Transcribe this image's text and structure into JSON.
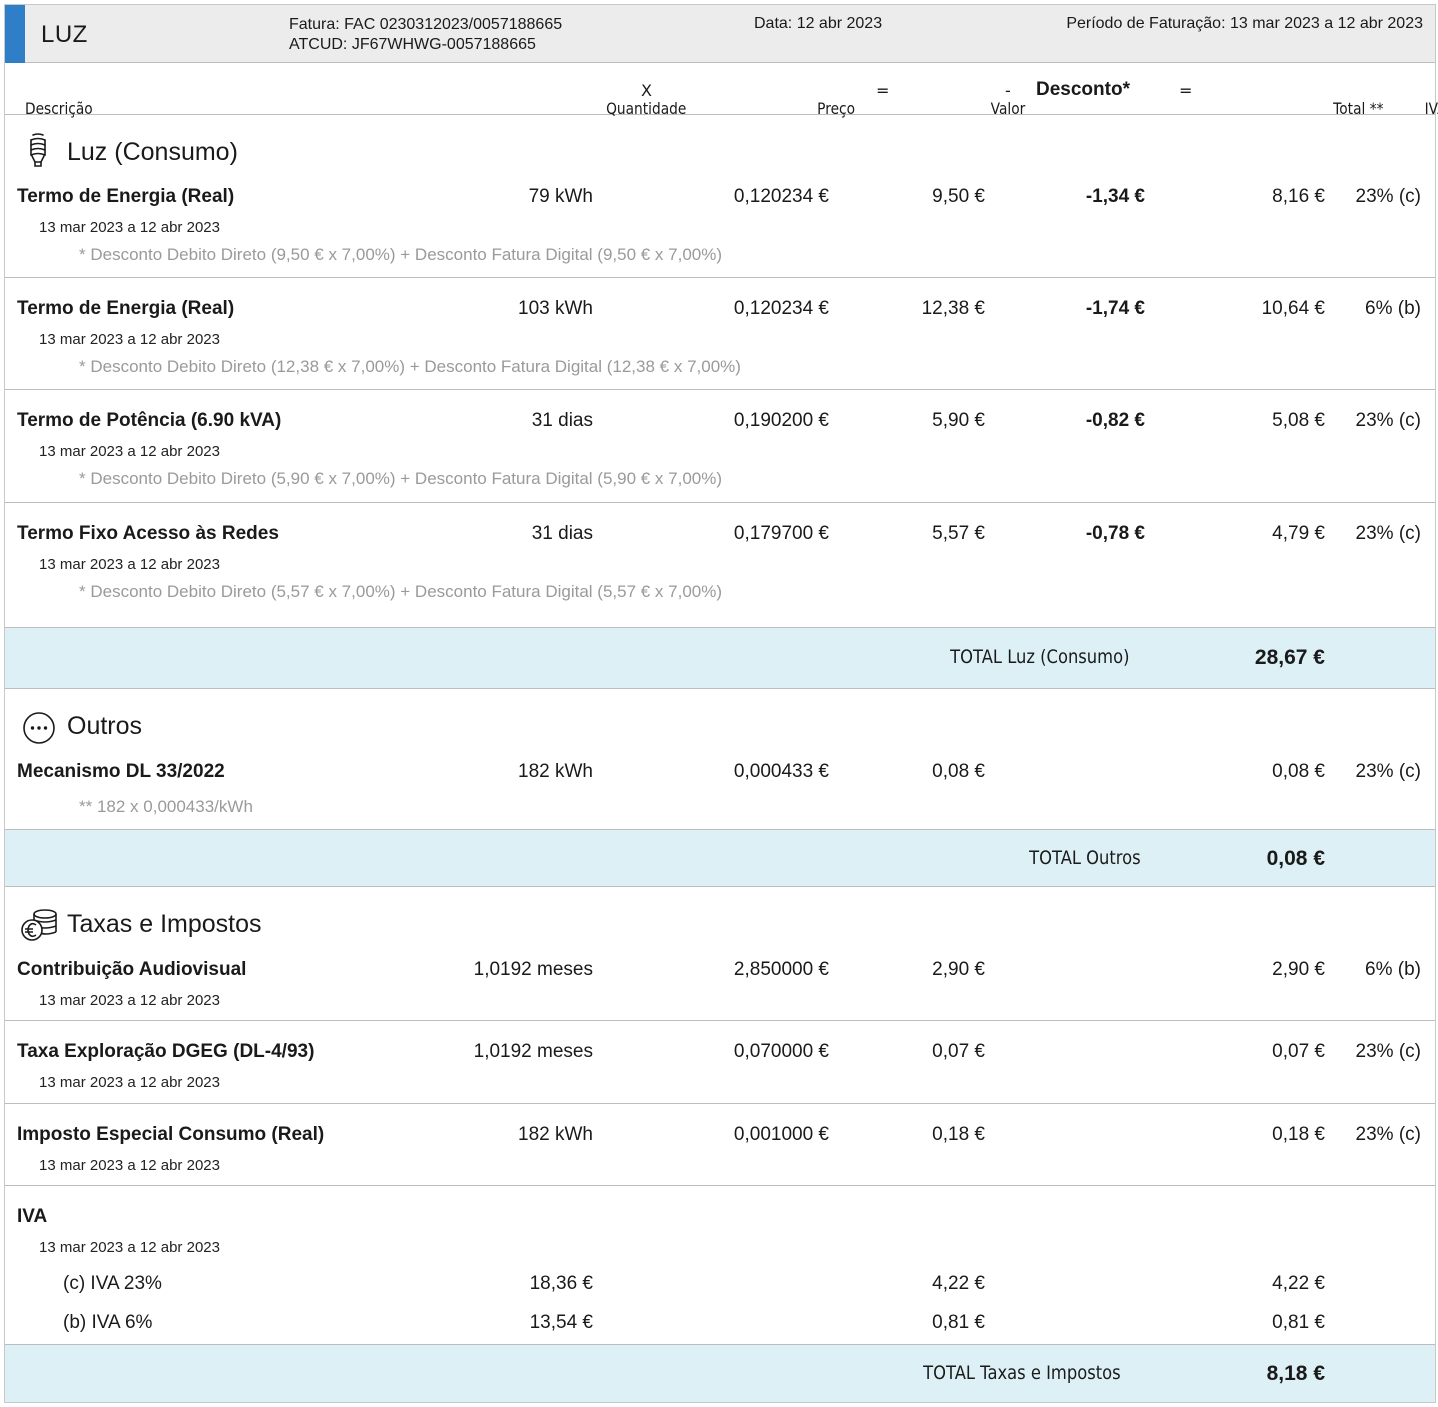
{
  "header": {
    "title": "LUZ",
    "fatura": "Fatura: FAC 0230312023/0057188665",
    "atcud": "ATCUD: JF67WHWG-0057188665",
    "data": "Data: 12 abr 2023",
    "periodo": "Período de Faturação:  13 mar 2023 a 12 abr 2023"
  },
  "columns": {
    "descricao": "Descrição",
    "quantidade": "Quantidade",
    "x": "X",
    "preco": "Preço",
    "eq1": "=",
    "valor": "Valor",
    "minus": "-",
    "desconto": "Desconto*",
    "eq2": "=",
    "total": "Total **",
    "iva": "IVA"
  },
  "sections": {
    "luz": {
      "title": "Luz (Consumo)",
      "icon": "lightbulb-icon",
      "items": [
        {
          "name": "Termo de Energia (Real)",
          "qty": "79 kWh",
          "price": "0,120234 €",
          "value": "9,50 €",
          "discount": "-1,34 €",
          "total": "8,16 €",
          "iva": "23% (c)",
          "period": "13 mar 2023 a 12 abr 2023",
          "note": "* Desconto Debito Direto (9,50 € x 7,00%) + Desconto Fatura Digital (9,50 € x 7,00%)"
        },
        {
          "name": "Termo de Energia (Real)",
          "qty": "103 kWh",
          "price": "0,120234 €",
          "value": "12,38 €",
          "discount": "-1,74 €",
          "total": "10,64 €",
          "iva": "6% (b)",
          "period": "13 mar 2023 a 12 abr 2023",
          "note": "* Desconto Debito Direto (12,38 € x 7,00%) + Desconto Fatura Digital (12,38 € x 7,00%)"
        },
        {
          "name": "Termo de Potência (6.90 kVA)",
          "qty": "31 dias",
          "price": "0,190200 €",
          "value": "5,90 €",
          "discount": "-0,82 €",
          "total": "5,08 €",
          "iva": "23% (c)",
          "period": "13 mar 2023 a 12 abr 2023",
          "note": "* Desconto Debito Direto (5,90 € x 7,00%) + Desconto Fatura Digital (5,90 € x 7,00%)"
        },
        {
          "name": "Termo Fixo Acesso às Redes",
          "qty": "31 dias",
          "price": "0,179700 €",
          "value": "5,57 €",
          "discount": "-0,78 €",
          "total": "4,79 €",
          "iva": "23% (c)",
          "period": "13 mar 2023 a 12 abr 2023",
          "note": "* Desconto Debito Direto (5,57 € x 7,00%) + Desconto Fatura Digital (5,57 € x 7,00%)"
        }
      ],
      "total_label": "TOTAL Luz (Consumo)",
      "total_value": "28,67 €"
    },
    "outros": {
      "title": "Outros",
      "icon": "more-icon",
      "items": [
        {
          "name": "Mecanismo DL 33/2022",
          "qty": "182 kWh",
          "price": "0,000433 €",
          "value": "0,08 €",
          "total": "0,08 €",
          "iva": "23% (c)",
          "note": "** 182 x 0,000433/kWh"
        }
      ],
      "total_label": "TOTAL Outros",
      "total_value": "0,08 €"
    },
    "taxas": {
      "title": "Taxas e Impostos",
      "icon": "coins-euro-icon",
      "items": [
        {
          "name": "Contribuição Audiovisual",
          "qty": "1,0192 meses",
          "price": "2,850000 €",
          "value": "2,90 €",
          "total": "2,90 €",
          "iva": "6% (b)",
          "period": "13 mar 2023 a 12 abr 2023"
        },
        {
          "name": "Taxa Exploração DGEG (DL-4/93)",
          "qty": "1,0192 meses",
          "price": "0,070000 €",
          "value": "0,07 €",
          "total": "0,07 €",
          "iva": "23% (c)",
          "period": "13 mar 2023 a 12 abr 2023"
        },
        {
          "name": "Imposto Especial Consumo (Real)",
          "qty": "182 kWh",
          "price": "0,001000 €",
          "value": "0,18 €",
          "total": "0,18 €",
          "iva": "23% (c)",
          "period": "13 mar 2023 a 12 abr 2023"
        }
      ],
      "iva": {
        "name": "IVA",
        "period": "13 mar 2023 a 12 abr 2023",
        "lines": [
          {
            "label": "(c) IVA 23%",
            "base": "18,36 €",
            "value": "4,22 €",
            "total": "4,22 €"
          },
          {
            "label": "(b) IVA 6%",
            "base": "13,54 €",
            "value": "0,81 €",
            "total": "0,81 €"
          }
        ]
      },
      "total_label": "TOTAL Taxas e Impostos",
      "total_value": "8,18 €"
    }
  }
}
